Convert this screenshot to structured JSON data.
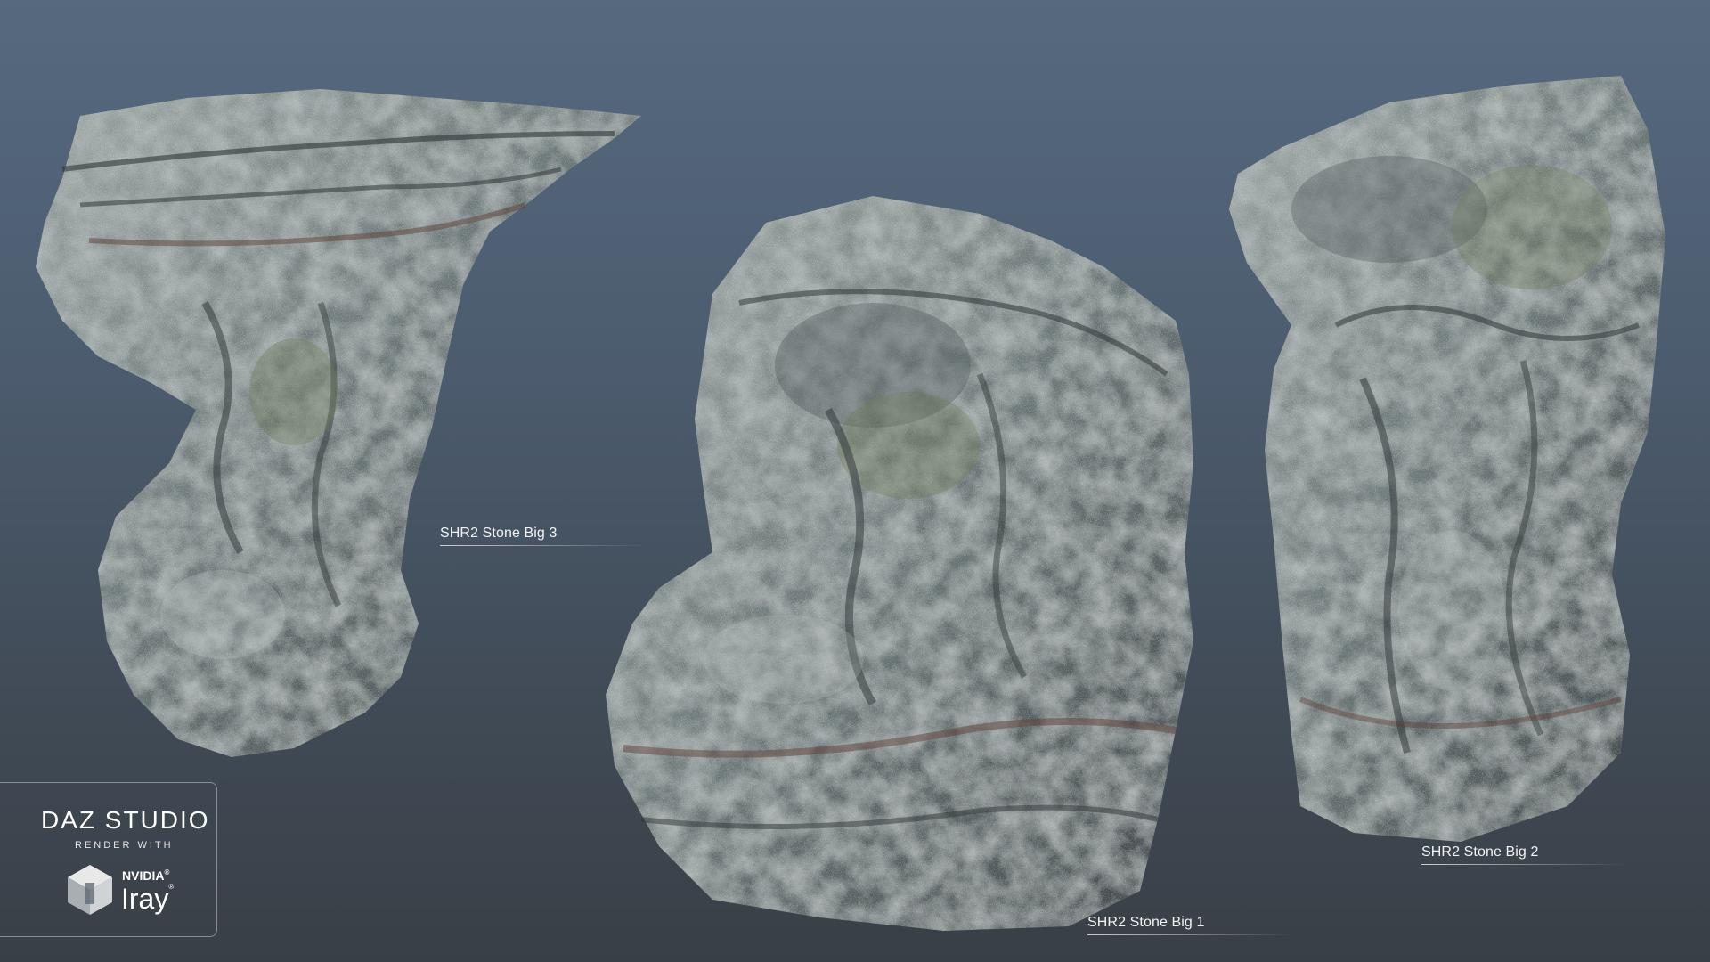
{
  "labels": {
    "stone_big_3": "SHR2 Stone Big 3",
    "stone_big_1": "SHR2 Stone Big 1",
    "stone_big_2": "SHR2 Stone Big 2"
  },
  "badge": {
    "brand": "DAZ STUDIO",
    "tagline": "RENDER WITH",
    "vendor": "NVIDIA",
    "product": "Iray",
    "registered": "®"
  },
  "colors": {
    "background_top": "#56697f",
    "background_bottom": "#393f46",
    "rock_base": "#6e7a7a",
    "rock_dark": "#3a4244",
    "rock_light": "#b9c2c0",
    "moss": "#6c7a55",
    "rust": "#6e4a3e",
    "label_text": "#f2f2f2"
  },
  "icons": {
    "iray_logo": "iray-cube-icon"
  }
}
